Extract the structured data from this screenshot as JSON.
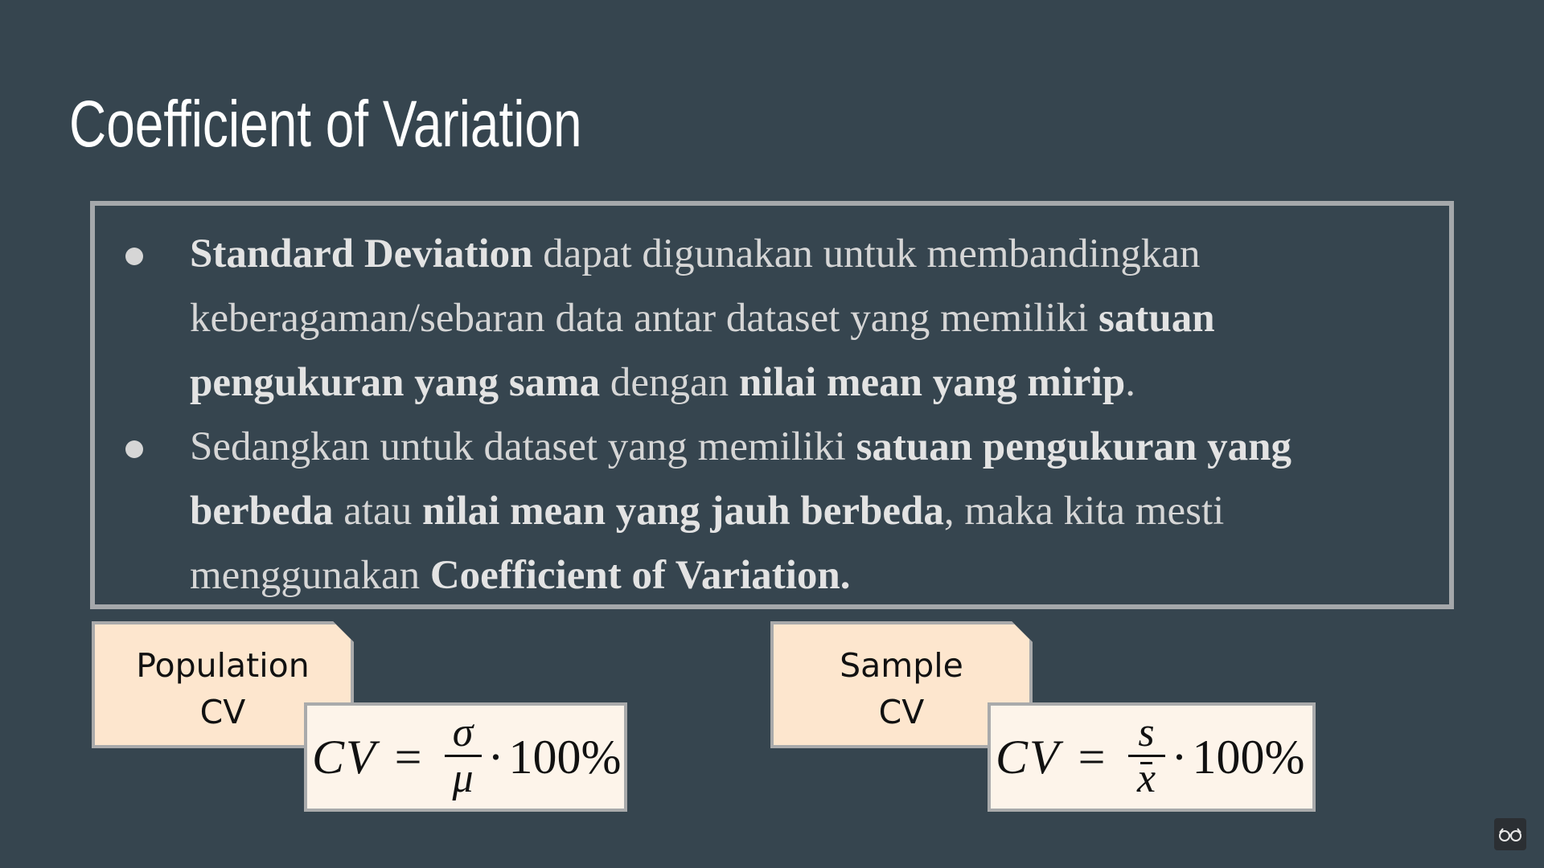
{
  "slide": {
    "title": "Coefficient of Variation"
  },
  "bullets": [
    {
      "parts": [
        {
          "t": "Standard Deviation",
          "b": true
        },
        {
          "t": " dapat digunakan untuk membandingkan keberagaman/sebaran data antar dataset yang memiliki ",
          "b": false
        },
        {
          "t": "satuan pengukuran yang sama",
          "b": true
        },
        {
          "t": " dengan ",
          "b": false
        },
        {
          "t": "nilai mean yang mirip",
          "b": true
        },
        {
          "t": ".",
          "b": false
        }
      ]
    },
    {
      "parts": [
        {
          "t": "Sedangkan untuk dataset yang memiliki ",
          "b": false
        },
        {
          "t": "satuan pengukuran yang berbeda",
          "b": true
        },
        {
          "t": " atau ",
          "b": false
        },
        {
          "t": "nilai mean yang jauh berbeda",
          "b": true
        },
        {
          "t": ", maka kita mesti menggunakan ",
          "b": false
        },
        {
          "t": "Coefficient of Variation.",
          "b": true
        }
      ]
    }
  ],
  "population": {
    "label_line1": "Population",
    "label_line2": "CV",
    "formula": {
      "lhs": "CV",
      "eq": "=",
      "numerator": "σ",
      "denominator": "μ",
      "dot": "·",
      "percent": "100%"
    }
  },
  "sample": {
    "label_line1": "Sample",
    "label_line2": "CV",
    "formula": {
      "lhs": "CV",
      "eq": "=",
      "numerator": "s",
      "denominator": "x",
      "dot": "·",
      "percent": "100%"
    }
  },
  "colors": {
    "background": "#36454f",
    "card": "#fde6ce",
    "formula_bg": "#fdf4ea",
    "border": "#a9aaab"
  },
  "icons": {
    "corner": "glasses-icon"
  }
}
